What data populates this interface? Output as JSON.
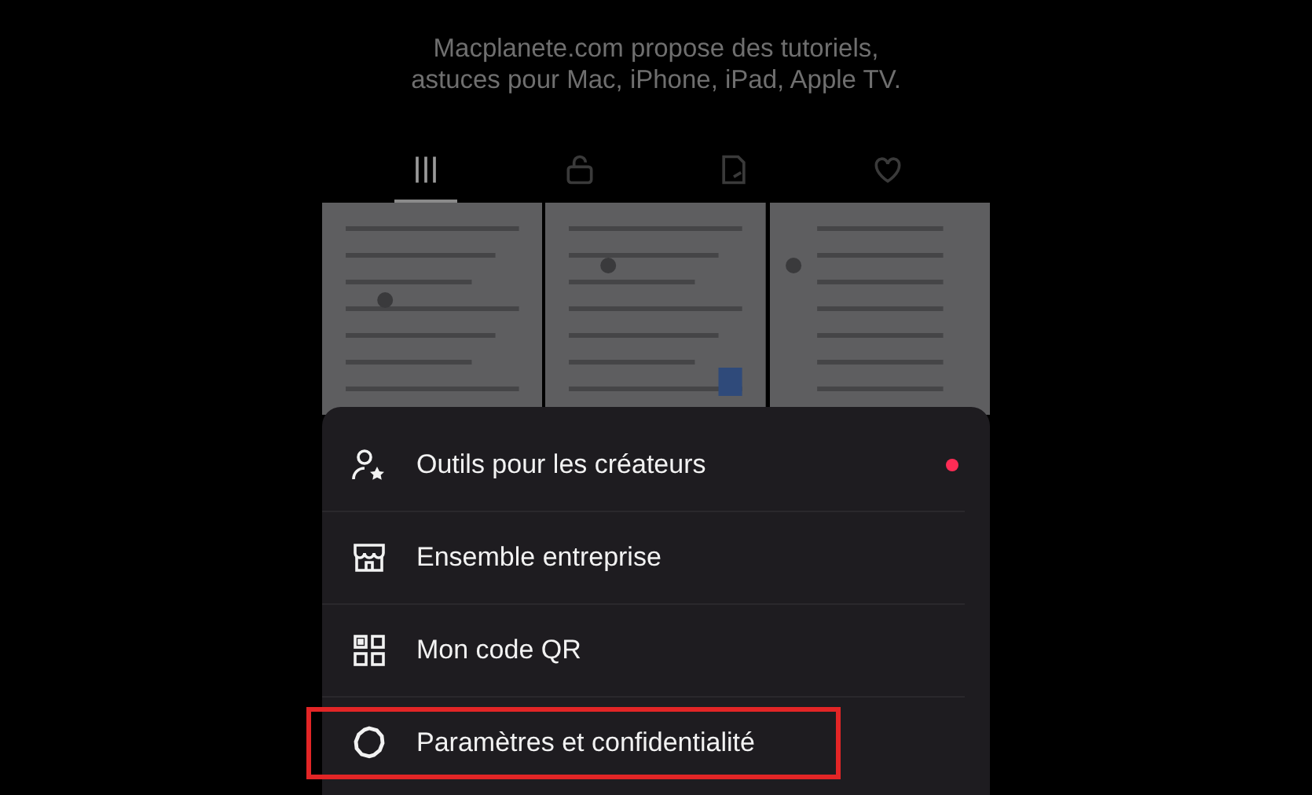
{
  "header": {
    "text": "Macplanete.com propose des tutoriels, astuces pour Mac, iPhone, iPad, Apple TV."
  },
  "tabs": [
    {
      "kind": "grid",
      "selected": true
    },
    {
      "kind": "lock",
      "selected": false
    },
    {
      "kind": "repost",
      "selected": false
    },
    {
      "kind": "heart",
      "selected": false
    }
  ],
  "menu": [
    {
      "kind": "creator",
      "label": "Outils pour les créateurs",
      "color": "#fe2c55",
      "highlighted": false
    },
    {
      "kind": "store",
      "label": "Ensemble entreprise",
      "highlighted": false
    },
    {
      "kind": "qr",
      "label": "Mon code QR",
      "highlighted": false
    },
    {
      "kind": "settings",
      "label": "Paramètres et confidentialité",
      "highlighted": true
    }
  ]
}
